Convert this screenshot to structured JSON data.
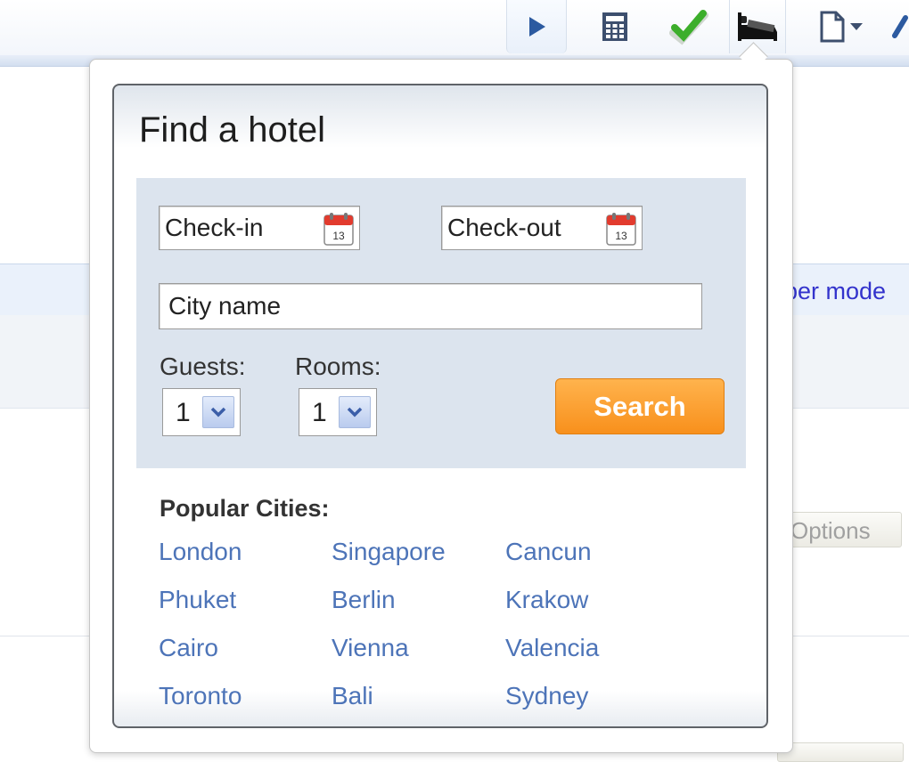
{
  "background": {
    "partial_link": "per mode",
    "options_button": "Options"
  },
  "toolbar": {
    "icons": [
      "play-icon",
      "calculator-icon",
      "checkmark-icon",
      "bed-icon",
      "page-icon",
      "dropdown-arrow-icon"
    ]
  },
  "popup": {
    "title": "Find a hotel",
    "checkin_placeholder": "Check-in",
    "checkout_placeholder": "Check-out",
    "calendar_day": "13",
    "city_placeholder": "City name",
    "guests_label": "Guests:",
    "guests_value": "1",
    "rooms_label": "Rooms:",
    "rooms_value": "1",
    "search_label": "Search",
    "popular_title": "Popular Cities:",
    "cities": [
      "London",
      "Singapore",
      "Cancun",
      "Phuket",
      "Berlin",
      "Krakow",
      "Cairo",
      "Vienna",
      "Valencia",
      "Toronto",
      "Bali",
      "Sydney"
    ]
  },
  "colors": {
    "accent_orange": "#f8901c",
    "link_blue": "#4d74b8",
    "form_bg": "#dce4ee"
  }
}
